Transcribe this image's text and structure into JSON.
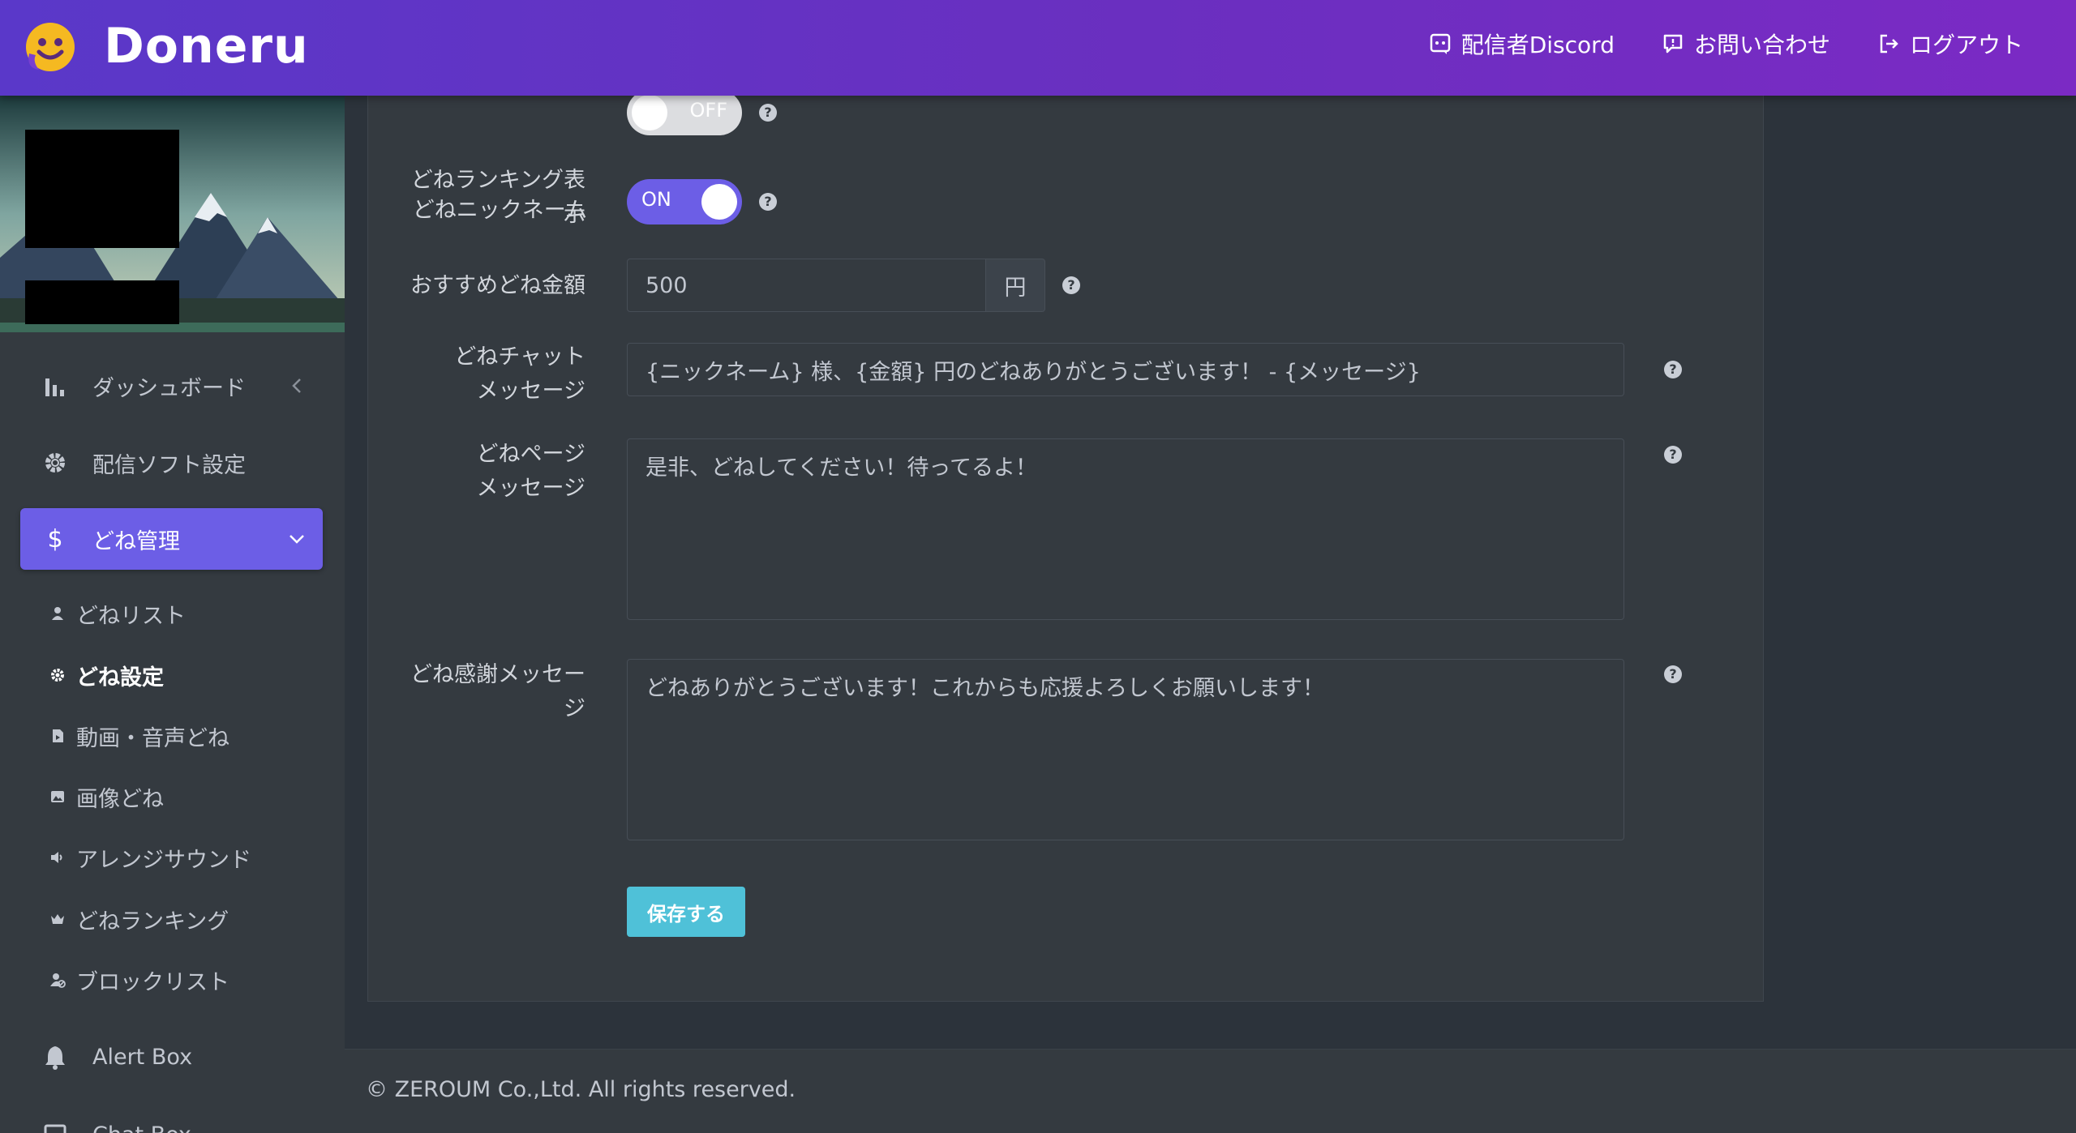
{
  "header": {
    "brand": "Doneru",
    "links": [
      {
        "label": "配信者Discord",
        "icon": "discord-icon"
      },
      {
        "label": "お問い合わせ",
        "icon": "message-icon"
      },
      {
        "label": "ログアウト",
        "icon": "logout-icon"
      }
    ],
    "gradient_start": "#5a38c9",
    "gradient_end": "#7b2ac4"
  },
  "sidebar": {
    "menu": [
      {
        "label": "ダッシュボード",
        "icon": "bar-chart-icon"
      },
      {
        "label": "配信ソフト設定",
        "icon": "gear-icon"
      },
      {
        "label": "どね管理",
        "icon": "dollar-icon"
      }
    ],
    "submenu": [
      {
        "label": "どねリスト",
        "icon": "user-icon"
      },
      {
        "label": "どね設定",
        "icon": "gear-icon"
      },
      {
        "label": "動画・音声どね",
        "icon": "video-file-icon"
      },
      {
        "label": "画像どね",
        "icon": "image-icon"
      },
      {
        "label": "アレンジサウンド",
        "icon": "volume-icon"
      },
      {
        "label": "どねランキング",
        "icon": "crown-icon"
      },
      {
        "label": "ブロックリスト",
        "icon": "user-block-icon"
      }
    ],
    "bottom": [
      {
        "label": "Alert Box",
        "icon": "bell-icon"
      },
      {
        "label": "Chat Box",
        "icon": "chat-icon"
      }
    ],
    "active_color": "#6c5ee6"
  },
  "form": {
    "nickname_label": "どねニックネーム",
    "nickname_toggle": "OFF",
    "ranking_label_1": "どねランキング表",
    "ranking_label_2": "示",
    "ranking_toggle": "ON",
    "amount_label": "おすすめどね金額",
    "amount_value": "500",
    "amount_unit": "円",
    "chat_label_1": "どねチャット",
    "chat_label_2": "メッセージ",
    "chat_value": "{ニックネーム} 様、{金額} 円のどねありがとうございます！ - {メッセージ}",
    "page_label_1": "どねページ",
    "page_label_2": "メッセージ",
    "page_value": "是非、どねしてください！待ってるよ！",
    "thanks_label_1": "どね感謝メッセー",
    "thanks_label_2": "ジ",
    "thanks_value": "どねありがとうございます！これからも応援よろしくお願いします！",
    "help_glyph": "?",
    "save_label": "保存する",
    "save_color": "#4fc1d8"
  },
  "footer": {
    "copyright": "© ZEROUM Co.,Ltd. All rights reserved."
  }
}
